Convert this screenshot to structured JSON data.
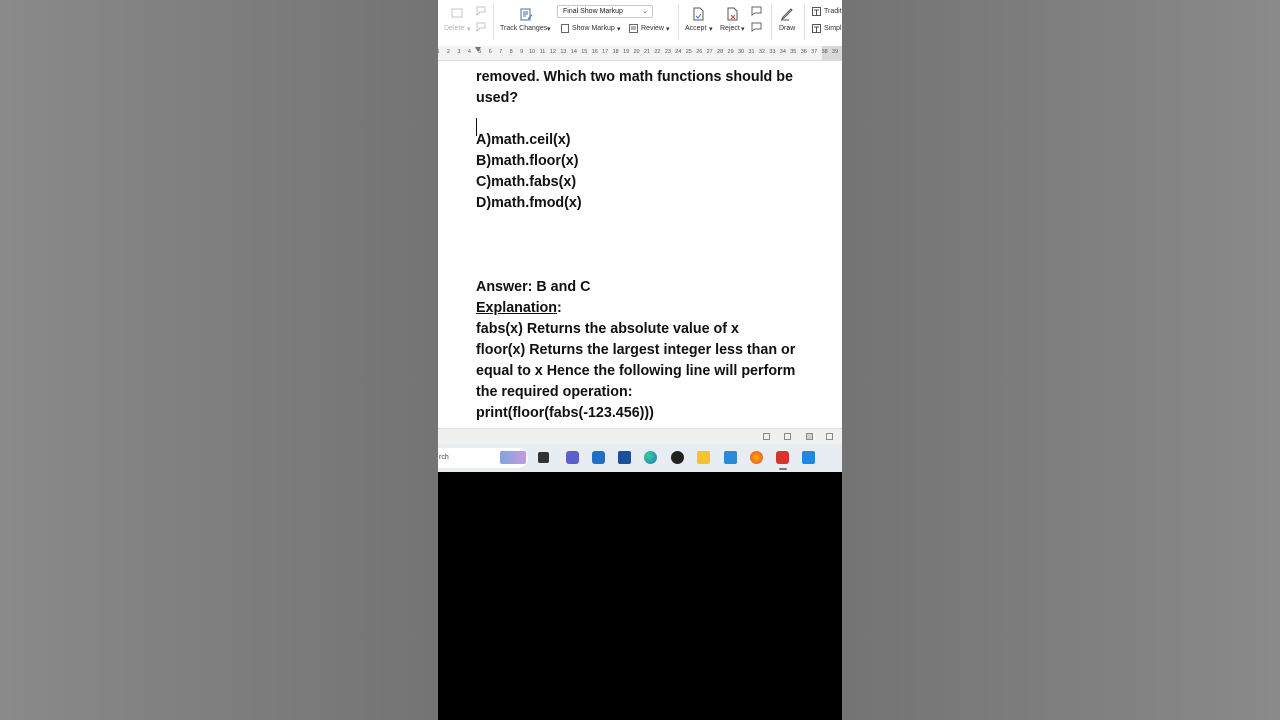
{
  "ribbon": {
    "delete_label": "Delete",
    "track_changes_label": "Track Changes",
    "markup_select_value": "Final Show Markup",
    "show_markup_label": "Show Markup",
    "review_label": "Review",
    "accept_label": "Accept",
    "reject_label": "Reject",
    "draw_label": "Draw",
    "traditional_label": "Tradit",
    "simplified_label": "Simpl"
  },
  "ruler": {
    "ticks": [
      "1",
      "2",
      "3",
      "4",
      "5",
      "6",
      "7",
      "8",
      "9",
      "10",
      "11",
      "12",
      "13",
      "14",
      "15",
      "16",
      "17",
      "18",
      "19",
      "20",
      "21",
      "22",
      "23",
      "24",
      "25",
      "26",
      "27",
      "28",
      "29",
      "30",
      "31",
      "32",
      "33",
      "34",
      "35",
      "36",
      "37",
      "38",
      "39"
    ]
  },
  "document": {
    "question_line1": "removed. Which two math functions should be",
    "question_line2": "used?",
    "options": [
      "A)math.ceil(x)",
      "B)math.floor(x)",
      "C)math.fabs(x)",
      "D)math.fmod(x)"
    ],
    "answer": "Answer: B and C",
    "explanation_label": "Explanation",
    "explanation_colon": ":",
    "explanation_lines": [
      "fabs(x) Returns the absolute value of x",
      "floor(x) Returns the largest integer less than or",
      "equal to x Hence the following line will perform",
      "the required operation:",
      "print(floor(fabs(-123.456)))"
    ]
  },
  "taskbar": {
    "search_text": "rch"
  }
}
